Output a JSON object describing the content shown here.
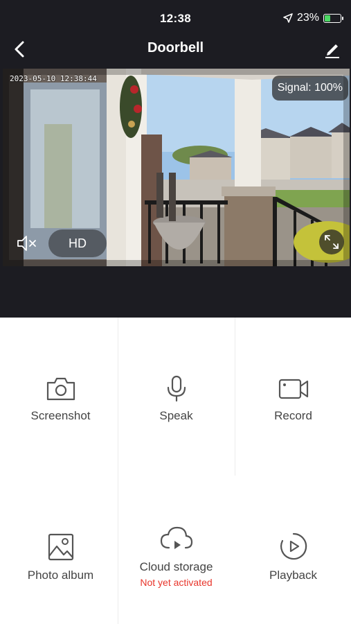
{
  "status_bar": {
    "time": "12:38",
    "battery_percent": "23%"
  },
  "nav": {
    "title": "Doorbell"
  },
  "video": {
    "timestamp": "2023-05-10 12:38:44",
    "signal": "Signal: 100%",
    "quality": "HD"
  },
  "actions": {
    "screenshot": "Screenshot",
    "speak": "Speak",
    "record": "Record",
    "photo_album": "Photo album",
    "cloud_storage": "Cloud storage",
    "cloud_status": "Not yet activated",
    "playback": "Playback"
  },
  "colors": {
    "header_bg": "#1c1c22",
    "warning": "#e8352b",
    "icon": "#555555"
  }
}
